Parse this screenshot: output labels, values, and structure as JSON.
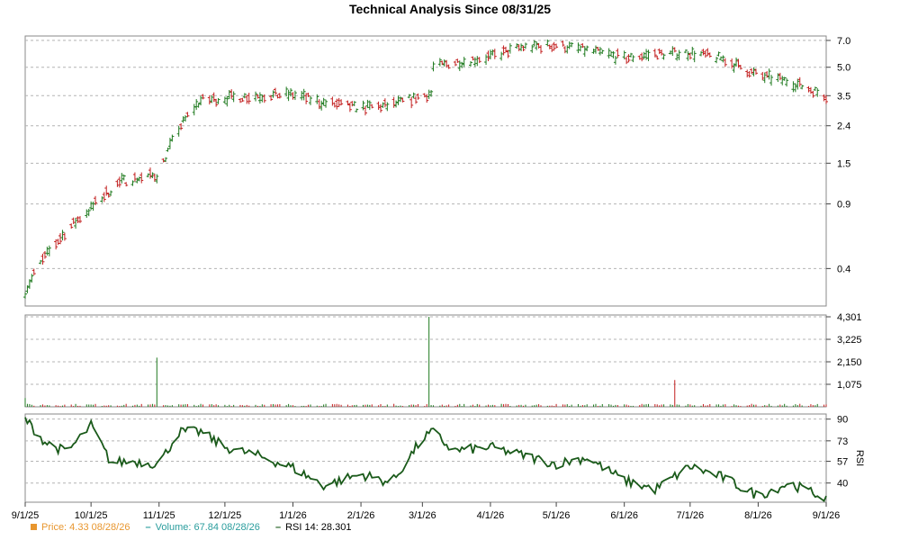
{
  "title": "Technical Analysis Since 08/31/25",
  "legend": {
    "price": "Price: 4.33  08/28/26",
    "volume": "Volume: 67.84  08/28/26",
    "rsi": "RSI 14: 28.301"
  },
  "colors": {
    "up": "#1f7a1f",
    "down": "#c21f1f",
    "price_legend": "#e8962e",
    "volume_legend": "#2a9d9d",
    "rsi_line": "#1a5a1a",
    "grid": "#b4b4b4"
  },
  "chart_data": [
    {
      "type": "line",
      "name": "price",
      "ylabel": "",
      "y_scale": "log",
      "y_ticks": [
        "7.0",
        "5.0",
        "3.5",
        "2.4",
        "1.5",
        "0.9",
        "0.4"
      ],
      "y_tick_values": [
        7.0,
        5.0,
        3.5,
        2.4,
        1.5,
        0.9,
        0.4
      ],
      "grid": true,
      "x": [
        "2025-09-01",
        "2025-09-15",
        "2025-10-01",
        "2025-10-15",
        "2025-11-01",
        "2025-11-10",
        "2025-11-20",
        "2025-12-01",
        "2025-12-15",
        "2026-01-01",
        "2026-01-15",
        "2026-02-01",
        "2026-02-15",
        "2026-03-01",
        "2026-03-05",
        "2026-03-06",
        "2026-03-15",
        "2026-04-01",
        "2026-04-15",
        "2026-05-01",
        "2026-05-15",
        "2026-06-01",
        "2026-06-15",
        "2026-07-01",
        "2026-07-15",
        "2026-08-01",
        "2026-08-15",
        "2026-09-01"
      ],
      "y": [
        0.3,
        0.55,
        0.85,
        1.2,
        1.3,
        2.3,
        3.3,
        3.4,
        3.5,
        3.55,
        3.2,
        3.0,
        3.1,
        3.5,
        3.6,
        5.0,
        5.3,
        5.7,
        6.4,
        6.6,
        6.2,
        5.6,
        5.9,
        6.0,
        5.6,
        4.5,
        4.2,
        3.5
      ]
    },
    {
      "type": "bar",
      "name": "volume",
      "y_ticks": [
        "4,301",
        "3,225",
        "2,150",
        "1,075"
      ],
      "y_tick_values": [
        4301,
        3225,
        2150,
        1075
      ],
      "spikes": [
        {
          "x": "2025-09-01",
          "value": 420
        },
        {
          "x": "2025-11-01",
          "value": 2350
        },
        {
          "x": "2026-03-05",
          "value": 4301
        },
        {
          "x": "2026-06-25",
          "value": 1280
        }
      ],
      "baseline_value": 120
    },
    {
      "type": "line",
      "name": "rsi",
      "ylabel": "RSI",
      "y_ticks": [
        "90",
        "73",
        "57",
        "40"
      ],
      "y_tick_values": [
        90,
        73,
        57,
        40
      ],
      "grid": true,
      "x": [
        "2025-09-01",
        "2025-09-10",
        "2025-09-20",
        "2025-10-01",
        "2025-10-10",
        "2025-10-20",
        "2025-11-01",
        "2025-11-10",
        "2025-11-20",
        "2025-12-01",
        "2025-12-15",
        "2026-01-01",
        "2026-01-15",
        "2026-02-01",
        "2026-02-15",
        "2026-03-01",
        "2026-03-06",
        "2026-03-15",
        "2026-04-01",
        "2026-04-15",
        "2026-05-01",
        "2026-05-15",
        "2026-06-01",
        "2026-06-15",
        "2026-07-01",
        "2026-07-15",
        "2026-08-01",
        "2026-08-15",
        "2026-09-01"
      ],
      "y": [
        90,
        72,
        64,
        85,
        56,
        57,
        55,
        80,
        80,
        68,
        62,
        52,
        38,
        47,
        40,
        75,
        80,
        65,
        68,
        62,
        55,
        60,
        42,
        35,
        53,
        45,
        30,
        40,
        28
      ]
    }
  ],
  "x_axis": {
    "ticks": [
      "9/1/25",
      "10/1/25",
      "11/1/25",
      "12/1/25",
      "1/1/26",
      "2/1/26",
      "3/1/26",
      "4/1/26",
      "5/1/26",
      "6/1/26",
      "7/1/26",
      "8/1/26",
      "9/1/26"
    ],
    "tick_dates": [
      "2025-09-01",
      "2025-10-01",
      "2025-11-01",
      "2025-12-01",
      "2026-01-01",
      "2026-02-01",
      "2026-03-01",
      "2026-04-01",
      "2026-05-01",
      "2026-06-01",
      "2026-07-01",
      "2026-08-01",
      "2026-09-01"
    ]
  }
}
